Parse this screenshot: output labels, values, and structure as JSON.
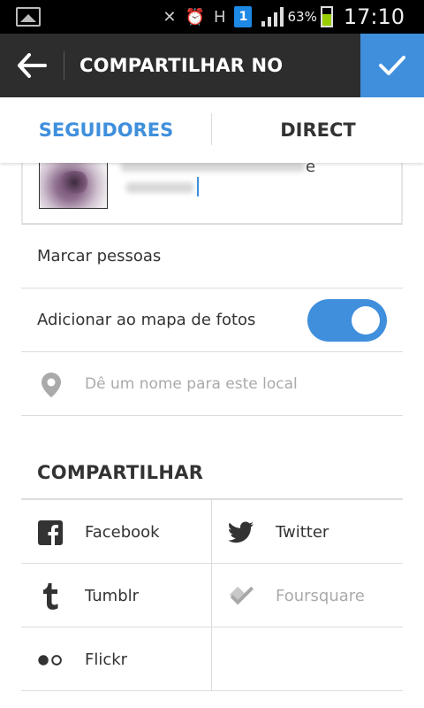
{
  "status_bar": {
    "battery_pct": "63%",
    "battery_level": 0.63,
    "time": "17:10",
    "notification_badge": "1",
    "network_letter": "H",
    "icons": [
      "gallery-icon",
      "mute-icon",
      "alarm-icon",
      "data-transfer-icon",
      "signal-icon",
      "battery-icon"
    ]
  },
  "header": {
    "title": "COMPARTILHAR NO",
    "back_icon": "back-arrow-icon",
    "confirm_icon": "checkmark-icon",
    "confirm_color": "#3f8fdc"
  },
  "tabs": [
    {
      "label": "SEGUIDORES",
      "active": true
    },
    {
      "label": "DIRECT",
      "active": false
    }
  ],
  "caption": {
    "visible_text_end": "e",
    "accent_color": "#3f8fdc"
  },
  "options": {
    "tag_people": "Marcar pessoas",
    "photo_map": {
      "label": "Adicionar ao mapa de fotos",
      "enabled": true
    },
    "location_placeholder": "Dê um nome para este local"
  },
  "share": {
    "title": "COMPARTILHAR",
    "services": [
      {
        "label": "Facebook",
        "icon": "facebook-icon",
        "enabled": true
      },
      {
        "label": "Twitter",
        "icon": "twitter-icon",
        "enabled": true
      },
      {
        "label": "Tumblr",
        "icon": "tumblr-icon",
        "enabled": true
      },
      {
        "label": "Foursquare",
        "icon": "foursquare-icon",
        "enabled": false
      },
      {
        "label": "Flickr",
        "icon": "flickr-icon",
        "enabled": true
      }
    ]
  }
}
